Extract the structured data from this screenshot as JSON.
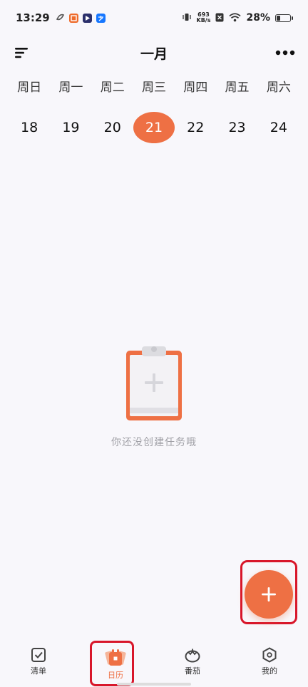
{
  "status_bar": {
    "time": "13:29",
    "net_speed_value": "693",
    "net_speed_unit": "KB/s",
    "battery_percent": "28%",
    "battery_level": 0.28
  },
  "header": {
    "title": "一月"
  },
  "week": {
    "labels": [
      "周日",
      "周一",
      "周二",
      "周三",
      "周四",
      "周五",
      "周六"
    ],
    "dates": [
      "18",
      "19",
      "20",
      "21",
      "22",
      "23",
      "24"
    ],
    "selected_index": 3
  },
  "empty_state": {
    "message": "你还没创建任务哦"
  },
  "nav": {
    "items": [
      {
        "label": "清单",
        "icon": "checkbox-icon"
      },
      {
        "label": "日历",
        "icon": "calendar-icon"
      },
      {
        "label": "番茄",
        "icon": "tomato-icon"
      },
      {
        "label": "我的",
        "icon": "profile-hexagon-icon"
      }
    ],
    "active_index": 1
  },
  "colors": {
    "accent": "#ee7044",
    "highlight": "#d8162a",
    "background": "#f8f7fb"
  }
}
